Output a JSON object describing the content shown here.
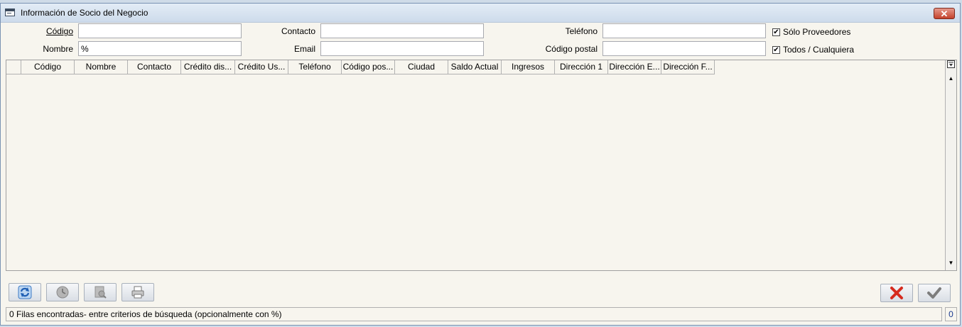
{
  "window": {
    "title": "Información de Socio del Negocio"
  },
  "form": {
    "codigo_label": "Código",
    "nombre_label": "Nombre",
    "nombre_value": "%",
    "contacto_label": "Contacto",
    "email_label": "Email",
    "telefono_label": "Teléfono",
    "codigo_postal_label": "Código postal",
    "solo_proveedores_label": "Sólo Proveedores",
    "solo_proveedores_checked": true,
    "todos_label": "Todos / Cualquiera",
    "todos_checked": true
  },
  "table": {
    "columns": [
      "Código",
      "Nombre",
      "Contacto",
      "Crédito dis...",
      "Crédito Us...",
      "Teléfono",
      "Código pos...",
      "Ciudad",
      "Saldo Actual",
      "Ingresos",
      "Dirección 1",
      "Dirección E...",
      "Dirección F..."
    ],
    "rows": []
  },
  "toolbar": {
    "refresh_icon": "refresh-icon",
    "history_icon": "history-icon",
    "zoom_icon": "zoom-icon",
    "print_icon": "print-icon",
    "cancel_icon": "cancel-icon",
    "ok_icon": "ok-icon"
  },
  "status": {
    "message": "0 Filas encontradas- entre criterios de búsqueda (opcionalmente con %)",
    "count": "0"
  },
  "colors": {
    "cancel": "#d62b1e",
    "ok": "#7d7d7d",
    "refresh": "#2a6fc9"
  }
}
